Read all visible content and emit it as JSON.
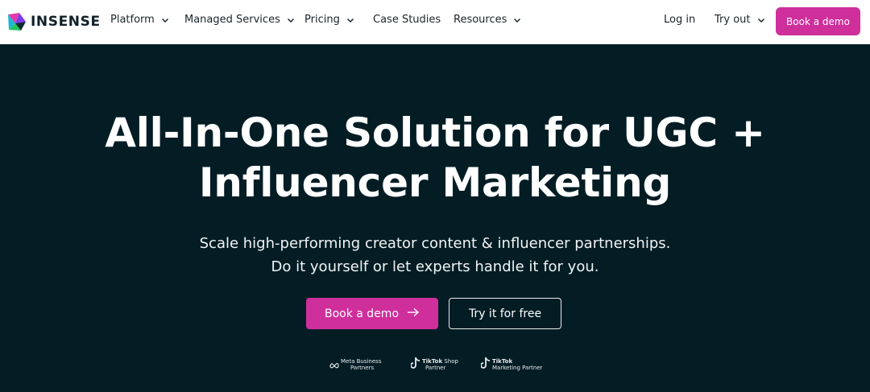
{
  "brand": {
    "name": "INSENSE",
    "accent": "#cf2f9b",
    "dark": "#041d25"
  },
  "nav": {
    "items": [
      {
        "label": "Platform",
        "has_dropdown": true
      },
      {
        "label": "Managed Services",
        "has_dropdown": true
      },
      {
        "label": "Pricing",
        "has_dropdown": true
      },
      {
        "label": "Case Studies",
        "has_dropdown": false
      },
      {
        "label": "Resources",
        "has_dropdown": true
      }
    ],
    "login": "Log in",
    "try_out": "Try out",
    "book_demo": "Book a demo"
  },
  "hero": {
    "title_line1": "All-In-One Solution for UGC +",
    "title_line2": "Influencer Marketing",
    "subtitle_line1": "Scale high-performing creator content & influencer partnerships.",
    "subtitle_line2": "Do it yourself or let experts handle it for you.",
    "primary_cta": "Book a demo",
    "secondary_cta": "Try it for free"
  },
  "partners": [
    {
      "icon": "meta-icon",
      "line1": "Meta Business",
      "line2": "Partners"
    },
    {
      "icon": "tiktok-icon",
      "line1_bold": "TikTok",
      "line1_rest": "Shop",
      "line2": "Partner"
    },
    {
      "icon": "tiktok-icon",
      "line1_bold": "TikTok",
      "line1_rest": "",
      "line2": "Marketing Partner"
    }
  ]
}
